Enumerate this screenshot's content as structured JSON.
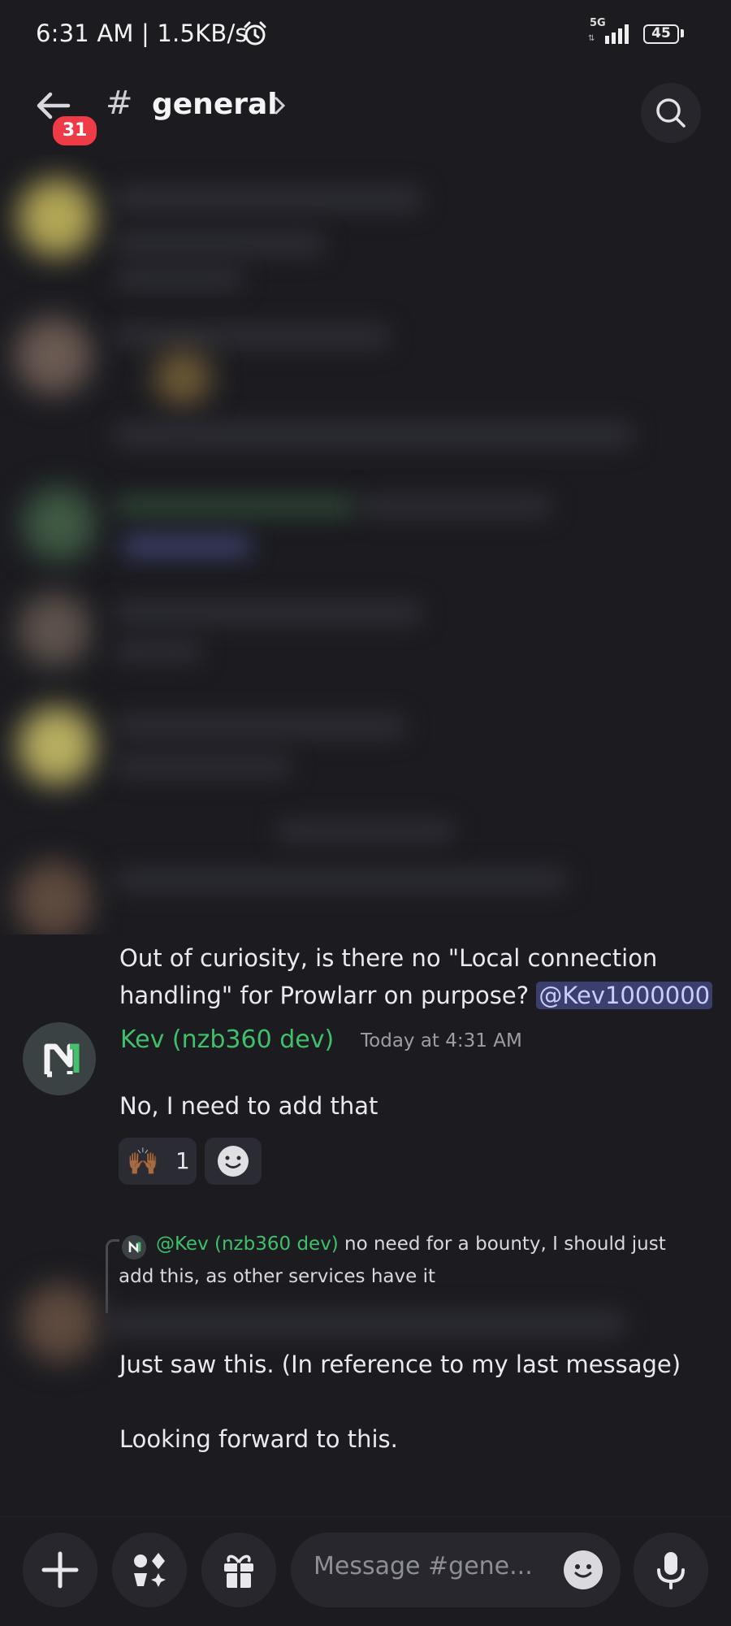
{
  "status_bar": {
    "time_speed": "6:31 AM | 1.5KB/s",
    "network": "5G",
    "battery": "45"
  },
  "header": {
    "unread_count": "31",
    "hash": "#",
    "channel": "general"
  },
  "messages": {
    "prev_text_line1": "Out of curiosity, is there no \"Local connection",
    "prev_text_line2": "handling\" for Prowlarr on purpose? ",
    "prev_mention": "@Kev1000000",
    "kev_author": "Kev (nzb360 dev)",
    "kev_timestamp": "Today at 4:31 AM",
    "kev_text": "No, I need to add that",
    "reaction_emoji": "🙌🏾",
    "reaction_count": "1",
    "reply_author": "@Kev (nzb360 dev)",
    "reply_text_1": "no need for a bounty, I should just",
    "reply_text_2": "add this, as other services have it",
    "last_line1": "Just saw this. (In reference to my last message)",
    "last_line2": "Looking forward to this."
  },
  "composer": {
    "placeholder": "Message #gene..."
  }
}
